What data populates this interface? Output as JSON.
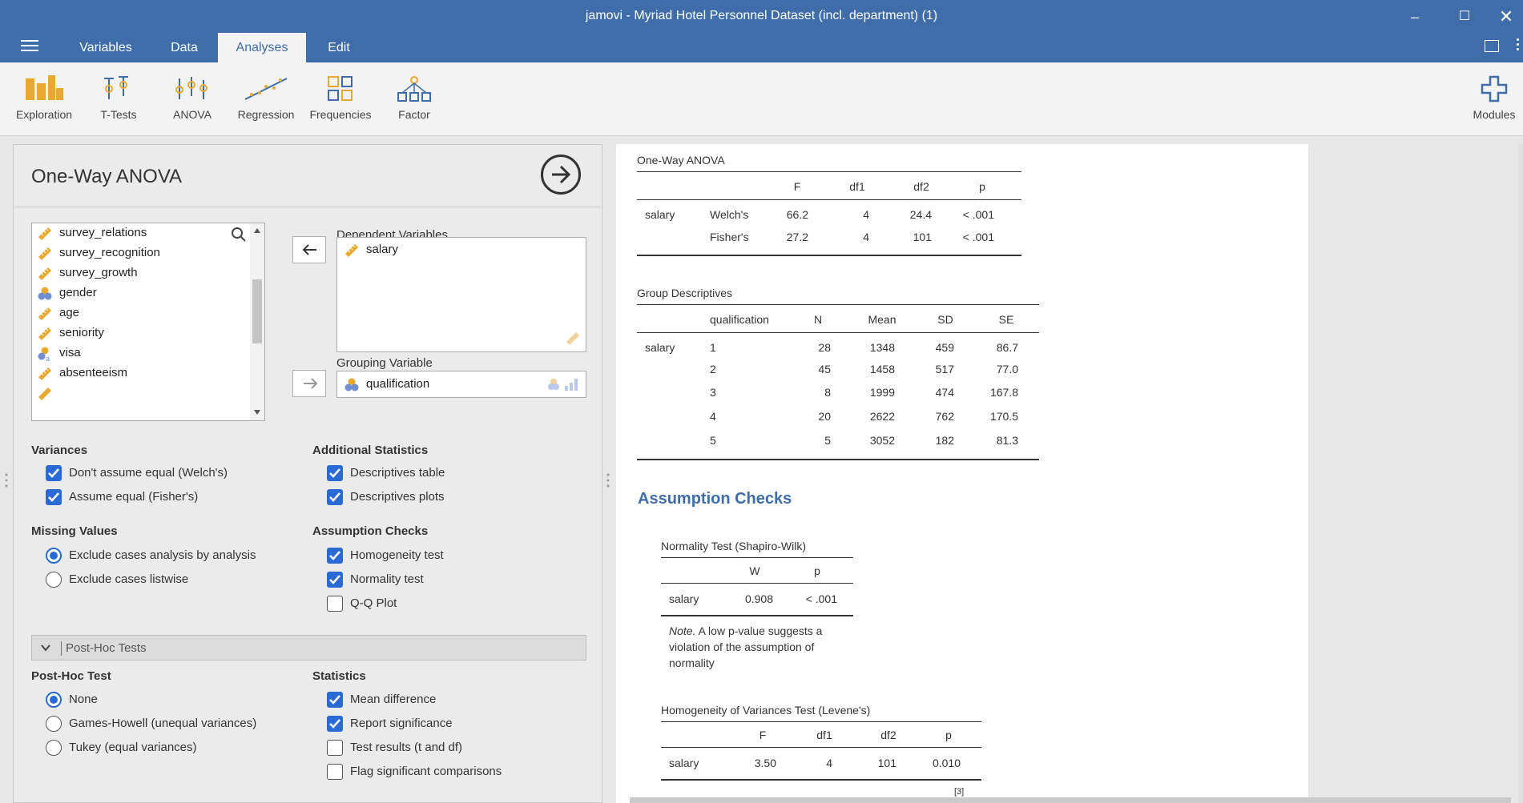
{
  "window": {
    "title": "jamovi - Myriad Hotel Personnel Dataset (incl. department) (1)"
  },
  "tabs": [
    {
      "label": "Variables"
    },
    {
      "label": "Data"
    },
    {
      "label": "Analyses"
    },
    {
      "label": "Edit"
    }
  ],
  "ribbon": [
    {
      "label": "Exploration",
      "icon": "bar-chart-icon"
    },
    {
      "label": "T-Tests",
      "icon": "t-tests-icon"
    },
    {
      "label": "ANOVA",
      "icon": "anova-icon"
    },
    {
      "label": "Regression",
      "icon": "regression-icon"
    },
    {
      "label": "Frequencies",
      "icon": "frequencies-icon"
    },
    {
      "label": "Factor",
      "icon": "factor-icon"
    },
    {
      "label": "Modules",
      "icon": "plus-icon"
    }
  ],
  "colors": {
    "accent": "#3e6da9",
    "checkbox": "#2a6ad4",
    "continuous": "#e8a930",
    "nominal": "#6f8fd0"
  },
  "options": {
    "title": "One-Way ANOVA",
    "variables": [
      {
        "name": "survey_relations",
        "type": "continuous"
      },
      {
        "name": "survey_recognition",
        "type": "continuous"
      },
      {
        "name": "survey_growth",
        "type": "continuous"
      },
      {
        "name": "gender",
        "type": "nominal"
      },
      {
        "name": "age",
        "type": "continuous"
      },
      {
        "name": "seniority",
        "type": "continuous"
      },
      {
        "name": "visa",
        "type": "nominal-text"
      },
      {
        "name": "absenteeism",
        "type": "continuous"
      }
    ],
    "dependent_label": "Dependent Variables",
    "dependent_value": "salary",
    "grouping_label": "Grouping Variable",
    "grouping_value": "qualification",
    "variances": {
      "heading": "Variances",
      "welch": {
        "label": "Don't assume equal (Welch's)",
        "checked": true
      },
      "fisher": {
        "label": "Assume equal (Fisher's)",
        "checked": true
      }
    },
    "additional": {
      "heading": "Additional Statistics",
      "desc_table": {
        "label": "Descriptives table",
        "checked": true
      },
      "desc_plots": {
        "label": "Descriptives plots",
        "checked": true
      }
    },
    "missing": {
      "heading": "Missing Values",
      "analysis": {
        "label": "Exclude cases analysis by analysis",
        "selected": true
      },
      "listwise": {
        "label": "Exclude cases listwise",
        "selected": false
      }
    },
    "assumption": {
      "heading": "Assumption Checks",
      "homogeneity": {
        "label": "Homogeneity test",
        "checked": true
      },
      "normality": {
        "label": "Normality test",
        "checked": true
      },
      "qq": {
        "label": "Q-Q Plot",
        "checked": false
      }
    },
    "posthoc_section": "Post-Hoc Tests",
    "posthoc": {
      "heading": "Post-Hoc Test",
      "none": {
        "label": "None",
        "selected": true
      },
      "games": {
        "label": "Games-Howell (unequal variances)",
        "selected": false
      },
      "tukey": {
        "label": "Tukey (equal variances)",
        "selected": false
      }
    },
    "statistics": {
      "heading": "Statistics",
      "mean_diff": {
        "label": "Mean difference",
        "checked": true
      },
      "report_sig": {
        "label": "Report significance",
        "checked": true
      },
      "test_results": {
        "label": "Test results (t and df)",
        "checked": false
      },
      "flag_sig": {
        "label": "Flag significant comparisons",
        "checked": false
      }
    }
  },
  "results": {
    "anova": {
      "title": "One-Way ANOVA",
      "headers": [
        "F",
        "df1",
        "df2",
        "p"
      ],
      "dv": "salary",
      "rows": [
        {
          "label": "Welch's",
          "F": "66.2",
          "df1": "4",
          "df2": "24.4",
          "p": "< .001"
        },
        {
          "label": "Fisher's",
          "F": "27.2",
          "df1": "4",
          "df2": "101",
          "p": "< .001"
        }
      ]
    },
    "descriptives": {
      "title": "Group Descriptives",
      "headers": [
        "qualification",
        "N",
        "Mean",
        "SD",
        "SE"
      ],
      "dv": "salary",
      "rows": [
        {
          "q": "1",
          "N": "28",
          "Mean": "1348",
          "SD": "459",
          "SE": "86.7"
        },
        {
          "q": "2",
          "N": "45",
          "Mean": "1458",
          "SD": "517",
          "SE": "77.0"
        },
        {
          "q": "3",
          "N": "8",
          "Mean": "1999",
          "SD": "474",
          "SE": "167.8"
        },
        {
          "q": "4",
          "N": "20",
          "Mean": "2622",
          "SD": "762",
          "SE": "170.5"
        },
        {
          "q": "5",
          "N": "5",
          "Mean": "3052",
          "SD": "182",
          "SE": "81.3"
        }
      ]
    },
    "assumption_heading": "Assumption Checks",
    "normality": {
      "title": "Normality Test (Shapiro-Wilk)",
      "headers": [
        "W",
        "p"
      ],
      "dv": "salary",
      "W": "0.908",
      "p": "< .001",
      "note_label": "Note.",
      "note_text": "A low p-value suggests a violation of the assumption of normality"
    },
    "levene": {
      "title": "Homogeneity of Variances Test (Levene's)",
      "headers": [
        "F",
        "df1",
        "df2",
        "p"
      ],
      "dv": "salary",
      "F": "3.50",
      "df1": "4",
      "df2": "101",
      "p": "0.010"
    },
    "footnote": "[3]"
  }
}
